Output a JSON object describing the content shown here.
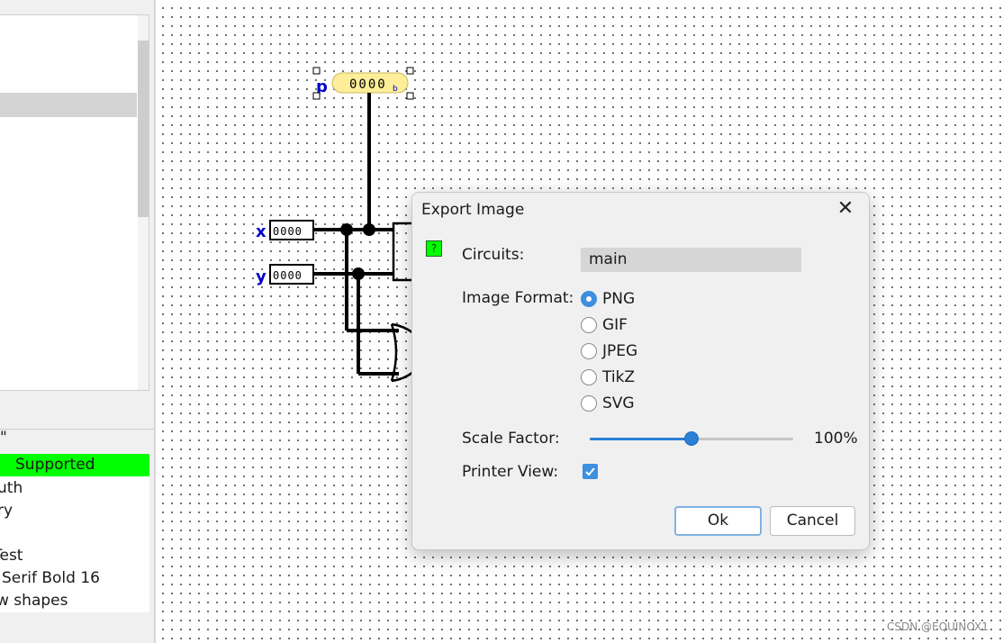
{
  "left_panel": {
    "props_quote": "\"",
    "props_rows": [
      {
        "text": "Supported",
        "highlight_color": "#00ff00"
      },
      {
        "text": "uth"
      },
      {
        "text": "ry"
      },
      {
        "text": ""
      },
      {
        "text": "Test"
      },
      {
        "text": "Serif Bold 16"
      },
      {
        "text": "w shapes"
      }
    ]
  },
  "canvas": {
    "probe": {
      "label": "p",
      "value": "0000",
      "radix": "b",
      "fill": "#ffee99"
    },
    "inputs": [
      {
        "label": "x",
        "value": "0000"
      },
      {
        "label": "y",
        "value": "0000"
      }
    ],
    "pin_label_color": "#0000cc",
    "wire_color": "#000000"
  },
  "dialog": {
    "title": "Export Image",
    "close_symbol": "✕",
    "help_icon": "?",
    "circuits_label": "Circuits:",
    "circuits_value": "main",
    "format_label": "Image Format:",
    "formats": [
      {
        "label": "PNG",
        "checked": true
      },
      {
        "label": "GIF",
        "checked": false
      },
      {
        "label": "JPEG",
        "checked": false
      },
      {
        "label": "TikZ",
        "checked": false
      },
      {
        "label": "SVG",
        "checked": false
      }
    ],
    "scale_label": "Scale Factor:",
    "scale_fraction": 0.5,
    "scale_value": "100%",
    "printer_label": "Printer View:",
    "printer_checked": true,
    "ok_label": "Ok",
    "cancel_label": "Cancel",
    "accent_color": "#3d8fe0"
  },
  "watermark": "CSDN @EQUINOX1"
}
